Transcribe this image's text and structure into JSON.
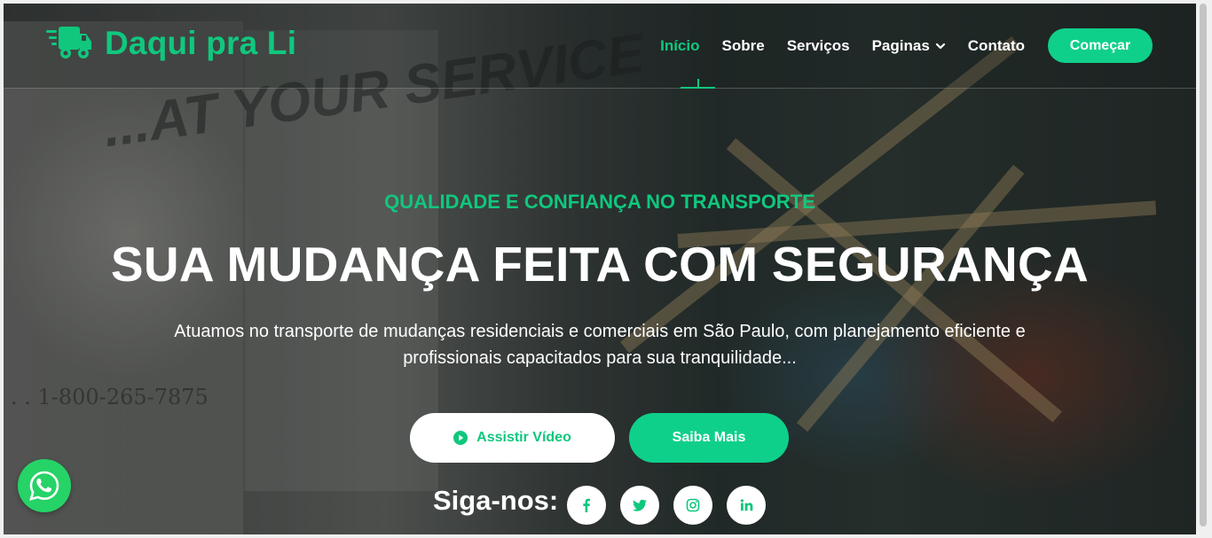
{
  "brand": {
    "name": "Daqui pra Li",
    "icon": "truck-fast-icon",
    "color": "#10c77e"
  },
  "nav": {
    "items": [
      {
        "label": "Início",
        "active": true
      },
      {
        "label": "Sobre"
      },
      {
        "label": "Serviços"
      },
      {
        "label": "Paginas",
        "dropdown": true
      },
      {
        "label": "Contato"
      }
    ],
    "cta": "Começar"
  },
  "hero": {
    "kicker": "QUALIDADE E CONFIANÇA NO TRANSPORTE",
    "headline": "SUA MUDANÇA FEITA COM SEGURANÇA",
    "lead": "Atuamos no transporte de mudanças residenciais e comerciais em São Paulo, com planejamento eficiente e profissionais capacitados para sua tranquilidade...",
    "buttons": {
      "video": "Assistir Vídeo",
      "more": "Saiba Mais"
    }
  },
  "social": {
    "label": "Siga-nos:",
    "icons": [
      "facebook-icon",
      "twitter-icon",
      "instagram-icon",
      "linkedin-icon"
    ]
  },
  "background_text": {
    "truck_slogan": "...AT YOUR SERVICE",
    "phone": ". . 1-800-265-7875"
  },
  "colors": {
    "accent": "#0fd08a",
    "whatsapp": "#25d366"
  }
}
